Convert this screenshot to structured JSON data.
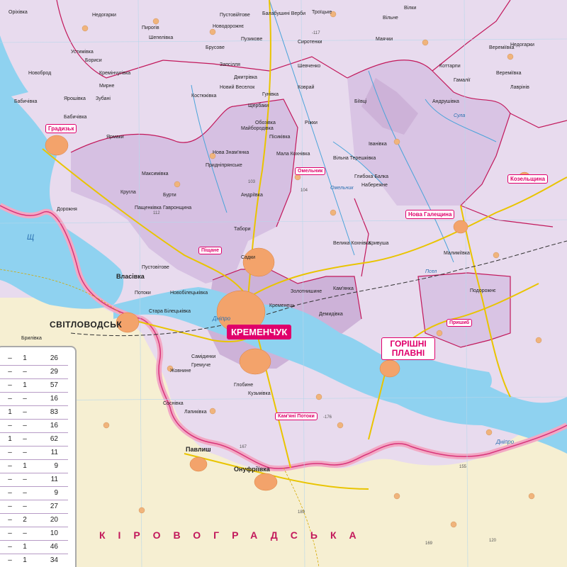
{
  "map": {
    "region_label": "КІРОВОГРАДСЬКА",
    "water_labels": [
      "Дніпро",
      "Омельник",
      "Сула",
      "Псел",
      "Дніпро",
      "Щ"
    ],
    "highlighted": {
      "kremenchuk": "КРЕМЕНЧУК",
      "horishni_plavni": "ГОРІШНІ ПЛАВНІ",
      "svitlovodsk": "СВІТЛОВОДСЬК",
      "hradyzk": "Градизьк",
      "kozelshchyna": "Козельщина",
      "nova_halesh": "Нова Галещина",
      "pishchane": "Піщане",
      "omelnyk": "Омельник",
      "pryshchepo": "Пришиб",
      "kam_potoky": "Кам'яні Потоки"
    },
    "towns": {
      "vlasivka": "Власівка",
      "onufriivka": "Онуфріївка",
      "pavlysh": "Павлиш"
    },
    "villages": [
      "Оріхівка",
      "Недогарки",
      "Пирогів",
      "Новодорожнє",
      "Пустовійтове",
      "Балабушині Верби",
      "Троїцьке",
      "Вільне",
      "Вілки",
      "Недогарки",
      "Шепелівка",
      "Брусове",
      "Пузикове",
      "Сиротенки",
      "Маячки",
      "Вереміївка",
      "Костюківка",
      "Новоброд",
      "Бориси",
      "Устимівка",
      "Ярошівка",
      "Зубані",
      "Гунівка",
      "Коврай",
      "Біївці",
      "Дмитрівка",
      "Шевченко",
      "Новий Веселок",
      "Щербаки",
      "Обозівка",
      "Пісиківка",
      "Кремінчугівка",
      "Бабичівка",
      "Коттарпи",
      "Вереміївка",
      "Гамалії",
      "Андрушівка",
      "Лаврінів",
      "Самідинки",
      "Гремуче",
      "Жовнине",
      "Стара Білецьківка",
      "Новобілецьківка",
      "Велика Кохнівка",
      "Кривуша",
      "Ріжки",
      "Кузьмівка",
      "Кременець",
      "Демидівка",
      "Садки",
      "Мала Кохнівка",
      "Придніпрянське",
      "Нова Знам'янка",
      "Майбородівка",
      "Мирне",
      "Ярмаки",
      "Бабичівка",
      "Глибока Балка",
      "Набережне",
      "Запсілля",
      "Кам'янка",
      "Пустовітове",
      "Потоки",
      "Лапиківка",
      "Іванівка",
      "Бурти",
      "Гавронщина",
      "Кругла",
      "Дорожня",
      "Пащенківка",
      "Максимівка",
      "Табори",
      "Андріївка",
      "Золотнишине",
      "Вільна Терешківка",
      "Соснівка",
      "Глобине",
      "Брилівка",
      "Малиміївка",
      "Подорожнє"
    ],
    "road_numbers": [
      "-117",
      "103",
      "104",
      "112",
      "-176",
      "167",
      "189",
      "155",
      "169",
      "120"
    ]
  },
  "legend": {
    "rows": [
      {
        "c1": "–",
        "c2": "1",
        "c3": "26"
      },
      {
        "c1": "–",
        "c2": "–",
        "c3": "29"
      },
      {
        "c1": "–",
        "c2": "1",
        "c3": "57"
      },
      {
        "c1": "–",
        "c2": "–",
        "c3": "16"
      },
      {
        "c1": "1",
        "c2": "–",
        "c3": "83"
      },
      {
        "c1": "–",
        "c2": "–",
        "c3": "16"
      },
      {
        "c1": "1",
        "c2": "–",
        "c3": "62"
      },
      {
        "c1": "–",
        "c2": "–",
        "c3": "11"
      },
      {
        "c1": "–",
        "c2": "1",
        "c3": "9"
      },
      {
        "c1": "–",
        "c2": "–",
        "c3": "11"
      },
      {
        "c1": "–",
        "c2": "–",
        "c3": "9"
      },
      {
        "c1": "–",
        "c2": "–",
        "c3": "27"
      },
      {
        "c1": "–",
        "c2": "2",
        "c3": "20"
      },
      {
        "c1": "–",
        "c2": "–",
        "c3": "10"
      },
      {
        "c1": "–",
        "c2": "1",
        "c3": "46"
      },
      {
        "c1": "–",
        "c2": "1",
        "c3": "34"
      }
    ]
  },
  "colors": {
    "land": "#f6efd2",
    "district": "#e6d8ec",
    "district_dark": "#cdb2d8",
    "water": "#8fd2f0",
    "border": "#d8347a",
    "road": "#e9c400"
  }
}
